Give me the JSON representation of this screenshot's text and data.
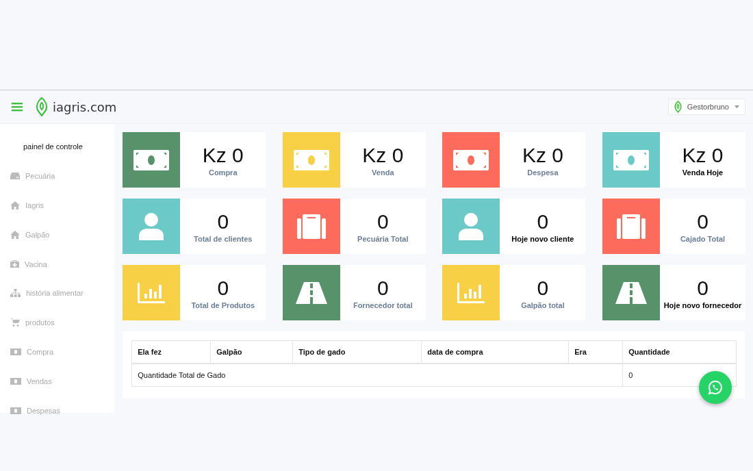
{
  "header": {
    "brand": "iagris.com",
    "user": "Gestorbruno"
  },
  "sidebar": {
    "items": [
      {
        "label": "painel de controle",
        "kind": "plain",
        "selected": true
      },
      {
        "label": "Pecuária",
        "kind": "drive",
        "selected": false
      },
      {
        "label": "Iagris",
        "kind": "home",
        "selected": false
      },
      {
        "label": "Galpão",
        "kind": "home",
        "selected": false
      },
      {
        "label": "Vacina",
        "kind": "medkit",
        "selected": false
      },
      {
        "label": "história alimentar",
        "kind": "sitemap",
        "selected": false
      },
      {
        "label": "produtos",
        "kind": "cart",
        "selected": false
      },
      {
        "label": "Compra",
        "kind": "money",
        "selected": false
      },
      {
        "label": "Vendas",
        "kind": "money",
        "selected": false
      },
      {
        "label": "Despesas",
        "kind": "money",
        "selected": false
      }
    ]
  },
  "stats": [
    {
      "value": "Kz 0",
      "label": "Compra",
      "kind": "money",
      "color": "#57926a",
      "emphasis": false
    },
    {
      "value": "Kz 0",
      "label": "Venda",
      "kind": "money",
      "color": "#f7d046",
      "emphasis": false
    },
    {
      "value": "Kz 0",
      "label": "Despesa",
      "kind": "money",
      "color": "#fd6b5d",
      "emphasis": false
    },
    {
      "value": "Kz 0",
      "label": "Venda Hoje",
      "kind": "money",
      "color": "#6bcac7",
      "emphasis": true
    },
    {
      "value": "0",
      "label": "Total de clientes",
      "kind": "user",
      "color": "#6bcac7",
      "emphasis": false
    },
    {
      "value": "0",
      "label": "Pecuária Total",
      "kind": "suitcase",
      "color": "#fd6b5d",
      "emphasis": false
    },
    {
      "value": "0",
      "label": "Hoje novo cliente",
      "kind": "user",
      "color": "#6bcac7",
      "emphasis": true
    },
    {
      "value": "0",
      "label": "Cajado Total",
      "kind": "suitcase",
      "color": "#fd6b5d",
      "emphasis": false
    },
    {
      "value": "0",
      "label": "Total de Produtos",
      "kind": "chart",
      "color": "#f7d046",
      "emphasis": false
    },
    {
      "value": "0",
      "label": "Fornecedor total",
      "kind": "road",
      "color": "#57926a",
      "emphasis": false
    },
    {
      "value": "0",
      "label": "Galpão total",
      "kind": "chart",
      "color": "#f7d046",
      "emphasis": false
    },
    {
      "value": "0",
      "label": "Hoje novo fornecedor",
      "kind": "road",
      "color": "#57926a",
      "emphasis": true
    }
  ],
  "table": {
    "columns": [
      "Ela fez",
      "Galpão",
      "Tipo de gado",
      "data de compra",
      "Era",
      "Quantidade"
    ],
    "total_row": {
      "label": "Quantidade Total de Gado",
      "value": "0"
    }
  }
}
